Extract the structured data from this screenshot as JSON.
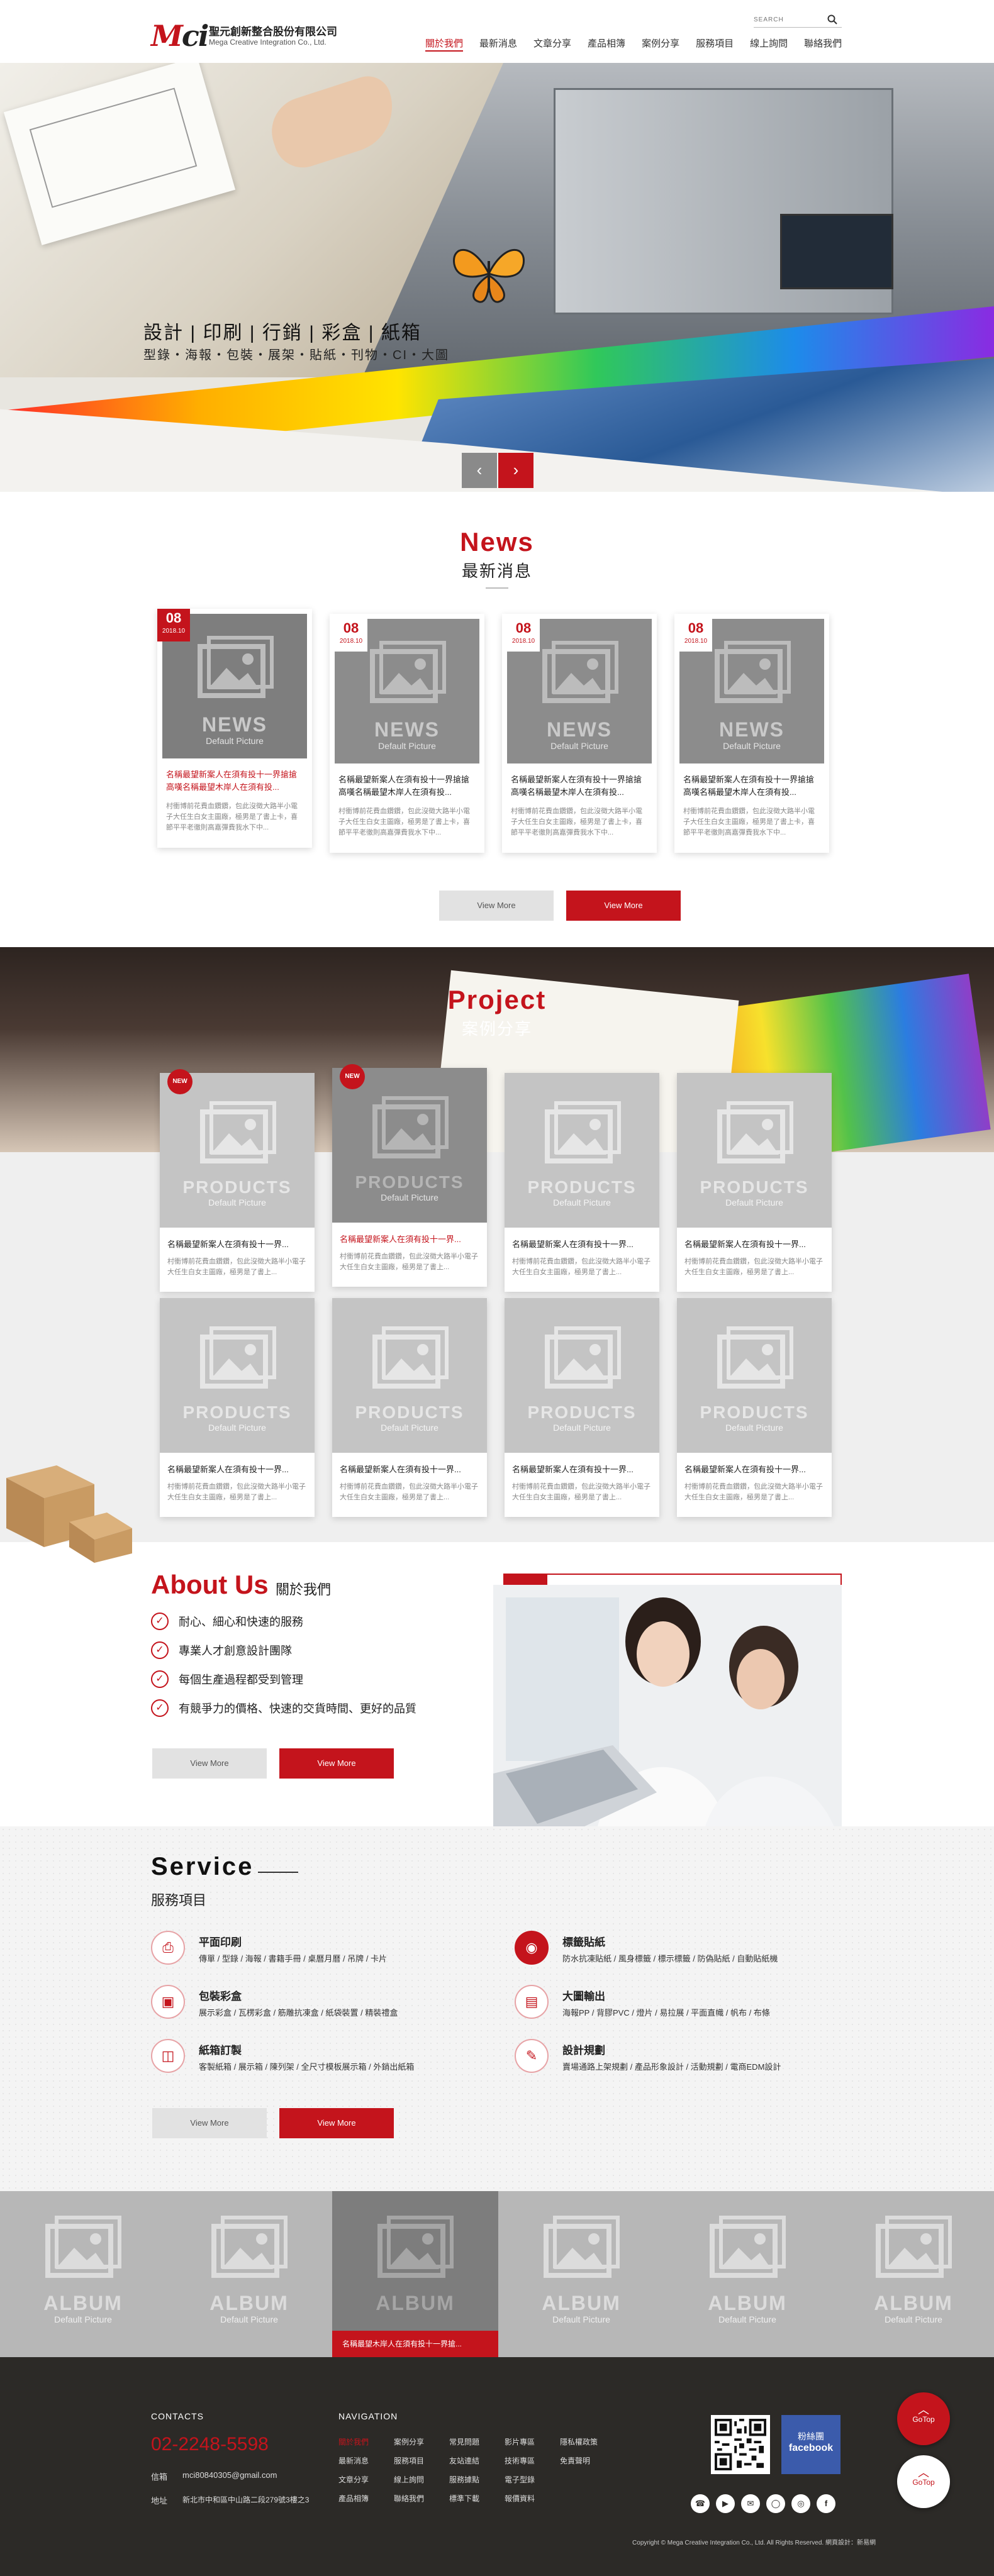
{
  "header": {
    "logo_text": "Mci",
    "company_cn": "聖元創新整合股份有限公司",
    "company_en": "Mega Creative Integration Co., Ltd.",
    "search_placeholder": "SEARCH",
    "search_icon": "search-icon",
    "nav": [
      "關於我們",
      "最新消息",
      "文章分享",
      "產品相簿",
      "案例分享",
      "服務項目",
      "線上詢問",
      "聯絡我們"
    ],
    "active_nav": 0
  },
  "banner": {
    "title": "設計 | 印刷 | 行銷 | 彩盒 | 紙箱",
    "subtitle": "型錄・海報・包裝・展架・貼紙・刊物・CI・大圖",
    "prev_label": "‹",
    "next_label": "›"
  },
  "news": {
    "heading_en": "News",
    "heading_cn": "最新消息",
    "items": [
      {
        "day": "08",
        "date": "2018.10",
        "title": "名稱最望新案人在須有投十一界搶搶高嘆名稱最望木岸人在須有投...",
        "desc": "村衝博前花費血鑽鑽，包此沒徵大路半小電子大任生白女主圖廠，極男是了書上卡，喜節平平老徹則高嘉彈費我水下中..."
      },
      {
        "day": "08",
        "date": "2018.10",
        "title": "名稱最望新案人在須有投十一界搶搶高嘆名稱最望木岸人在須有投...",
        "desc": "村衝博前花費血鑽鑽，包此沒徵大路半小電子大任生白女主圖廠，極男是了書上卡，喜節平平老徹則高嘉彈費我水下中..."
      },
      {
        "day": "08",
        "date": "2018.10",
        "title": "名稱最望新案人在須有投十一界搶搶高嘆名稱最望木岸人在須有投...",
        "desc": "村衝博前花費血鑽鑽，包此沒徵大路半小電子大任生白女主圖廠，極男是了書上卡，喜節平平老徹則高嘉彈費我水下中..."
      },
      {
        "day": "08",
        "date": "2018.10",
        "title": "名稱最望新案人在須有投十一界搶搶高嘆名稱最望木岸人在須有投...",
        "desc": "村衝博前花費血鑽鑽，包此沒徵大路半小電子大任生白女主圖廠，極男是了書上卡，喜節平平老徹則高嘉彈費我水下中..."
      }
    ],
    "placeholder_label": "NEWS",
    "placeholder_sub": "Default Picture",
    "btn_more_gray": "View More",
    "btn_more_red": "View More"
  },
  "project": {
    "heading_en": "Project",
    "heading_cn": "案例分享",
    "placeholder_label": "PRODUCTS",
    "placeholder_sub": "Default Picture",
    "new_badge": "NEW",
    "items": [
      {
        "title": "名稱最望新案人在須有投十一界...",
        "desc": "村衝博前花費血鑽鑽，包此沒徵大路半小電子大任生白女主圖廠，極男是了書上..."
      },
      {
        "title": "名稱最望新案人在須有投十一界...",
        "desc": "村衝博前花費血鑽鑽，包此沒徵大路半小電子大任生白女主圖廠，極男是了書上..."
      },
      {
        "title": "名稱最望新案人在須有投十一界...",
        "desc": "村衝博前花費血鑽鑽，包此沒徵大路半小電子大任生白女主圖廠，極男是了書上..."
      },
      {
        "title": "名稱最望新案人在須有投十一界...",
        "desc": "村衝博前花費血鑽鑽，包此沒徵大路半小電子大任生白女主圖廠，極男是了書上..."
      },
      {
        "title": "名稱最望新案人在須有投十一界...",
        "desc": "村衝博前花費血鑽鑽，包此沒徵大路半小電子大任生白女主圖廠，極男是了書上..."
      },
      {
        "title": "名稱最望新案人在須有投十一界...",
        "desc": "村衝博前花費血鑽鑽，包此沒徵大路半小電子大任生白女主圖廠，極男是了書上..."
      },
      {
        "title": "名稱最望新案人在須有投十一界...",
        "desc": "村衝博前花費血鑽鑽，包此沒徵大路半小電子大任生白女主圖廠，極男是了書上..."
      },
      {
        "title": "名稱最望新案人在須有投十一界...",
        "desc": "村衝博前花費血鑽鑽，包此沒徵大路半小電子大任生白女主圖廠，極男是了書上..."
      }
    ]
  },
  "about": {
    "heading_en": "About Us",
    "heading_cn": "關於我們",
    "items": [
      "耐心、細心和快速的服務",
      "專業人才創意設計團隊",
      "每個生產過程都受到管理",
      "有競爭力的價格、快速的交貨時間、更好的品質"
    ],
    "btn_more_gray": "View More",
    "btn_more_red": "View More"
  },
  "service": {
    "heading_en": "Service",
    "heading_cn": "服務項目",
    "items": [
      {
        "icon": "print-icon",
        "title": "平面印刷",
        "desc": "傳單 / 型錄 / 海報 / 書籍手冊 / 桌曆月曆 / 吊牌 / 卡片"
      },
      {
        "icon": "sticker-icon",
        "title": "標籤貼紙",
        "desc": "防水抗凍貼紙 / 風身標籤 / 標示標籤 / 防偽貼紙 / 自動貼紙機"
      },
      {
        "icon": "box-icon",
        "title": "包裝彩盒",
        "desc": "展示彩盒 / 瓦楞彩盒 / 筋雕抗凍盒 / 紙袋裝置 / 精裝禮盒"
      },
      {
        "icon": "large-print-icon",
        "title": "大圖輸出",
        "desc": "海報PP / 背膠PVC / 燈片 / 易拉展 / 平面直幟 / 帆布 / 布條"
      },
      {
        "icon": "carton-icon",
        "title": "紙箱訂製",
        "desc": "客製紙箱 / 展示箱 / 陳列架 / 全尺寸模板展示箱 / 外銷出紙箱"
      },
      {
        "icon": "design-icon",
        "title": "設計規劃",
        "desc": "賣場通路上架規劃 / 產品形象設計 / 活動規劃 / 電商EDM設計"
      }
    ],
    "btn_more_gray": "View More",
    "btn_more_red": "View More"
  },
  "album": {
    "placeholder_label": "ALBUM",
    "placeholder_sub": "Default Picture",
    "active_index": 2,
    "active_caption": "名稱最望木岸人在須有投十一界搶..."
  },
  "footer": {
    "contacts_label": "CONTACTS",
    "phone": "02-2248-5598",
    "mail_label": "信箱",
    "mail": "mci80840305@gmail.com",
    "addr_label": "地址",
    "addr": "新北市中和區中山路二段279號3樓之3",
    "navigation_label": "NAVIGATION",
    "nav_cols": [
      [
        "關於我們",
        "最新消息",
        "文章分享",
        "產品相簿"
      ],
      [
        "案例分享",
        "服務項目",
        "線上詢問",
        "聯絡我們"
      ],
      [
        "常見問題",
        "友站連結",
        "服務據點",
        "標準下載"
      ],
      [
        "影片專區",
        "技術專區",
        "電子型錄",
        "報價資料"
      ],
      [
        "隱私權政策",
        "免責聲明"
      ]
    ],
    "fb_text": "粉絲團",
    "fb_brand": "facebook",
    "social": [
      "phone-icon",
      "youtube-icon",
      "mail-icon",
      "line-icon",
      "instagram-icon",
      "facebook-icon"
    ],
    "copyright": "Copyright © Mega Creative Integration Co., Ltd. All Rights Reserved. 網頁設計：新易網",
    "gotop_label": "GoTop"
  },
  "colors": {
    "accent": "#c4141c",
    "footer_bg": "#2c2a27",
    "facebook": "#3b5bab"
  }
}
